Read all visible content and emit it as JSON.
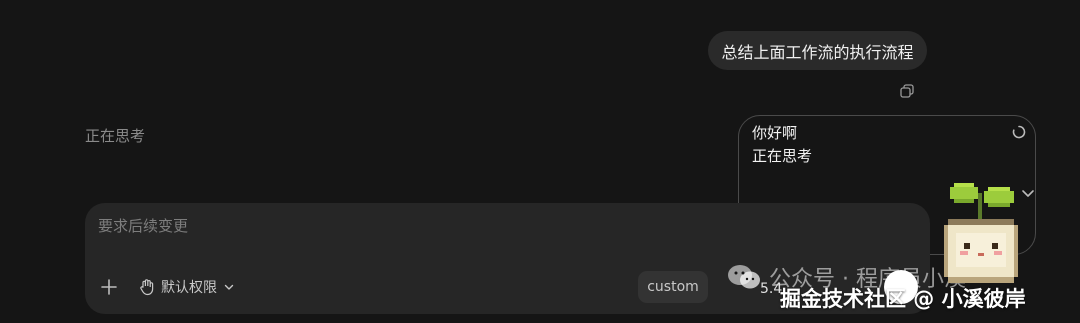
{
  "conversation": {
    "user_message": "总结上面工作流的执行流程",
    "status": "正在思考"
  },
  "mini_window": {
    "greeting": "你好啊",
    "status": "正在思考"
  },
  "composer": {
    "placeholder": "要求后续变更",
    "permission_label": "默认权限",
    "model_label": "custom",
    "version_text": "5.4"
  },
  "watermark": {
    "line1": "公众号 · 程序员小溪",
    "line2": "掘金技术社区 @ 小溪彼岸"
  },
  "colors": {
    "background": "#151515",
    "bubble": "#2a2a2a",
    "composer": "#262626",
    "chip": "#333333"
  },
  "icons": [
    "copy-icon",
    "spinner-icon",
    "chevron-down-icon",
    "plus-icon",
    "hand-icon",
    "wechat-icon",
    "sprout-mascot"
  ]
}
